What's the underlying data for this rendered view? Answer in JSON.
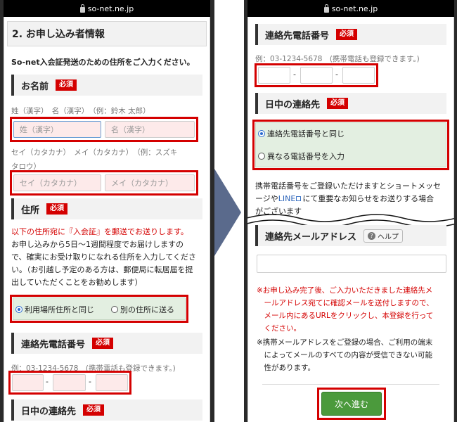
{
  "browser": {
    "url": "so-net.ne.jp"
  },
  "left_screen": {
    "section_title": "2. お申し込み者情報",
    "intro": "So-net入会証発送のための住所をご入力ください。",
    "required_badge": "必須",
    "name": {
      "heading": "お名前",
      "kanji_hint": "姓（漢字）　名（漢字）　（例：鈴木 太郎）",
      "last_kanji_placeholder": "姓（漢字）",
      "first_kanji_placeholder": "名（漢字）",
      "kana_hint_line1": "セイ（カタカナ）　メイ（カタカナ）　（例：スズキ",
      "kana_hint_line2": "タロウ）",
      "last_kana_placeholder": "セイ（カタカナ）",
      "first_kana_placeholder": "メイ（カタカナ）"
    },
    "address": {
      "heading": "住所",
      "notice_red": "以下の住所宛に『入会証』を郵送でお送りします。",
      "notice_lines": [
        "お申し込みから5日〜1週間程度でお届けしますの",
        "で、確実にお受け取りになれる住所を入力してくださ",
        "い。（お引越し予定のある方は、郵便局に転居届を提",
        "出していただくことをお勧めします）"
      ],
      "option_same": "利用場所住所と同じ",
      "option_other": "別の住所に送る"
    },
    "phone": {
      "heading": "連絡先電話番号",
      "hint": "例：03-1234-5678　(携帯電話も登録できます。)",
      "dash": "-"
    },
    "daytime": {
      "heading": "日中の連絡先"
    }
  },
  "right_screen": {
    "required_badge": "必須",
    "phone": {
      "heading": "連絡先電話番号",
      "hint": "例：03-1234-5678　(携帯電話も登録できます。)",
      "dash": "-"
    },
    "daytime": {
      "heading": "日中の連絡先",
      "option_same": "連絡先電話番号と同じ",
      "option_other": "異なる電話番号を入力"
    },
    "info_line1": "携帯電話番号をご登録いただけますとショートメッセ",
    "info_line2_pre": "ージや",
    "info_line2_link": "LINE",
    "info_line2_post": "にて重要なお知らせをお送りする場合",
    "info_line3": "がございます",
    "email": {
      "heading": "連絡先メールアドレス",
      "help_label": "ヘルプ",
      "notes": [
        "※お申し込み完了後、ご入力いただきました連絡先メ",
        "　ールアドレス宛てに確認メールを送付しますので、",
        "　メール内にあるURLをクリックし、本登録を行って",
        "　ください。",
        "※携帯メールアドレスをご登録の場合、ご利用の端末",
        "　によってメールのすべての内容が受信できない可能",
        "　性があります。"
      ]
    },
    "next_button": "次へ進む"
  }
}
